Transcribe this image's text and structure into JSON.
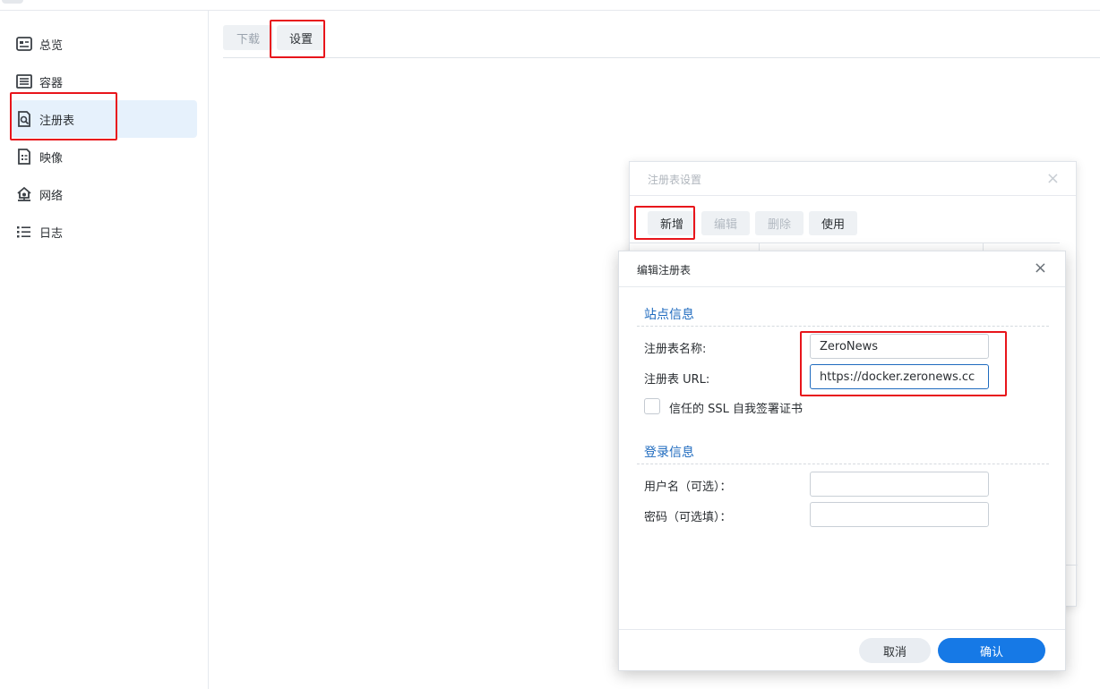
{
  "sidebar": {
    "items": [
      {
        "label": "总览",
        "icon": "overview-icon"
      },
      {
        "label": "容器",
        "icon": "container-list-icon"
      },
      {
        "label": "注册表",
        "icon": "registry-search-icon",
        "active": true
      },
      {
        "label": "映像",
        "icon": "image-file-icon"
      },
      {
        "label": "网络",
        "icon": "network-home-icon"
      },
      {
        "label": "日志",
        "icon": "log-list-icon"
      }
    ]
  },
  "tabs": {
    "download": "下载",
    "settings": "设置"
  },
  "registry_settings_dialog": {
    "title": "注册表设置",
    "close": "×",
    "toolbar": {
      "add": "新增",
      "edit": "编辑",
      "delete": "删除",
      "use": "使用"
    }
  },
  "edit_registry_dialog": {
    "title": "编辑注册表",
    "close": "×",
    "site_section": "站点信息",
    "registry_name_label": "注册表名称:",
    "registry_name_value": "ZeroNews",
    "registry_url_label": "注册表 URL:",
    "registry_url_value": "https://docker.zeronews.cc",
    "trust_ssl_label": "信任的 SSL 自我签署证书",
    "login_section": "登录信息",
    "username_label": "用户名（可选）：",
    "username_value": "",
    "password_label": "密码（可选填）：",
    "password_value": "",
    "cancel": "取消",
    "confirm": "确认"
  },
  "colors": {
    "accent": "#1679e6",
    "section_title": "#1f6bbf",
    "active_nav_bg": "#e6f1fc",
    "highlight_box": "#e8151b"
  }
}
